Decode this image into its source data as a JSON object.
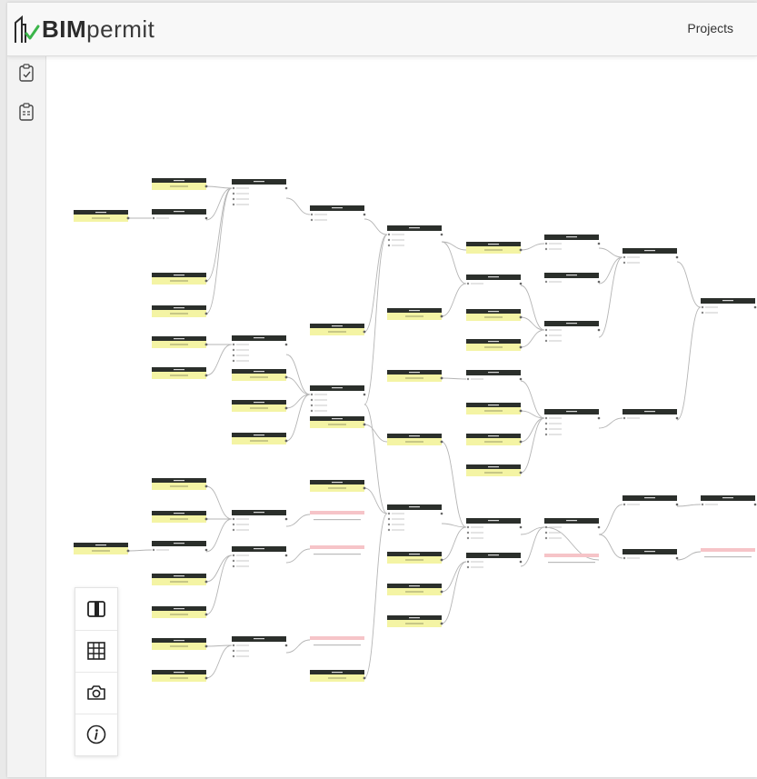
{
  "header": {
    "brand_bold": "BIM",
    "brand_light": "permit",
    "projects_label": "Projects"
  },
  "sidebar": {
    "items": [
      {
        "name": "clipboard-check-icon"
      },
      {
        "name": "clipboard-list-icon"
      }
    ]
  },
  "toolbar": {
    "buttons": [
      {
        "name": "panel-toggle-icon"
      },
      {
        "name": "grid-icon"
      },
      {
        "name": "camera-icon"
      },
      {
        "name": "info-icon"
      }
    ]
  },
  "colors": {
    "node_header": "#2b2f2b",
    "node_body_yellow": "#f4f4a4",
    "node_body_pink": "#f6c4c8",
    "edge": "#b5b5b5",
    "brand_check": "#3bb54a"
  }
}
